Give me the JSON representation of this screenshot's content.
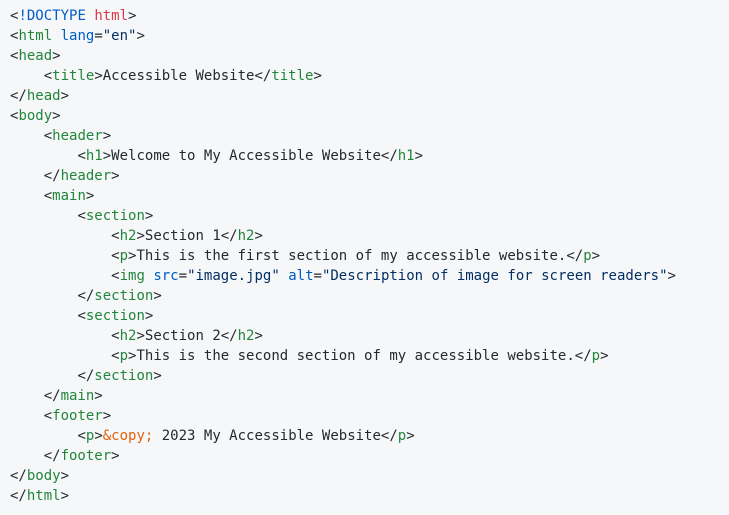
{
  "colors": {
    "background": "#f6f7f9",
    "text": "#24292e",
    "tag": "#22863a",
    "attr": "#005cc5",
    "string": "#032f62",
    "entity": "#e36209",
    "keyword": "#d73a49"
  },
  "lines": [
    [
      [
        "<",
        "p"
      ],
      [
        "!DOCTYPE",
        "doctype"
      ],
      [
        " ",
        "text"
      ],
      [
        "html",
        "red"
      ],
      [
        ">",
        "p"
      ]
    ],
    [
      [
        "<",
        "p"
      ],
      [
        "html",
        "tag"
      ],
      [
        " ",
        "text"
      ],
      [
        "lang",
        "attr"
      ],
      [
        "=",
        "p"
      ],
      [
        "\"en\"",
        "str"
      ],
      [
        ">",
        "p"
      ]
    ],
    [
      [
        "<",
        "p"
      ],
      [
        "head",
        "tag"
      ],
      [
        ">",
        "p"
      ]
    ],
    [
      [
        "    ",
        "text"
      ],
      [
        "<",
        "p"
      ],
      [
        "title",
        "tag"
      ],
      [
        ">",
        "p"
      ],
      [
        "Accessible Website",
        "text"
      ],
      [
        "</",
        "p"
      ],
      [
        "title",
        "tag"
      ],
      [
        ">",
        "p"
      ]
    ],
    [
      [
        "</",
        "p"
      ],
      [
        "head",
        "tag"
      ],
      [
        ">",
        "p"
      ]
    ],
    [
      [
        "<",
        "p"
      ],
      [
        "body",
        "tag"
      ],
      [
        ">",
        "p"
      ]
    ],
    [
      [
        "    ",
        "text"
      ],
      [
        "<",
        "p"
      ],
      [
        "header",
        "tag"
      ],
      [
        ">",
        "p"
      ]
    ],
    [
      [
        "        ",
        "text"
      ],
      [
        "<",
        "p"
      ],
      [
        "h1",
        "tag"
      ],
      [
        ">",
        "p"
      ],
      [
        "Welcome to My Accessible Website",
        "text"
      ],
      [
        "</",
        "p"
      ],
      [
        "h1",
        "tag"
      ],
      [
        ">",
        "p"
      ]
    ],
    [
      [
        "    ",
        "text"
      ],
      [
        "</",
        "p"
      ],
      [
        "header",
        "tag"
      ],
      [
        ">",
        "p"
      ]
    ],
    [
      [
        "    ",
        "text"
      ],
      [
        "<",
        "p"
      ],
      [
        "main",
        "tag"
      ],
      [
        ">",
        "p"
      ]
    ],
    [
      [
        "        ",
        "text"
      ],
      [
        "<",
        "p"
      ],
      [
        "section",
        "tag"
      ],
      [
        ">",
        "p"
      ]
    ],
    [
      [
        "            ",
        "text"
      ],
      [
        "<",
        "p"
      ],
      [
        "h2",
        "tag"
      ],
      [
        ">",
        "p"
      ],
      [
        "Section 1",
        "text"
      ],
      [
        "</",
        "p"
      ],
      [
        "h2",
        "tag"
      ],
      [
        ">",
        "p"
      ]
    ],
    [
      [
        "            ",
        "text"
      ],
      [
        "<",
        "p"
      ],
      [
        "p",
        "tag"
      ],
      [
        ">",
        "p"
      ],
      [
        "This is the first section of my accessible website.",
        "text"
      ],
      [
        "</",
        "p"
      ],
      [
        "p",
        "tag"
      ],
      [
        ">",
        "p"
      ]
    ],
    [
      [
        "            ",
        "text"
      ],
      [
        "<",
        "p"
      ],
      [
        "img",
        "tag"
      ],
      [
        " ",
        "text"
      ],
      [
        "src",
        "attr"
      ],
      [
        "=",
        "p"
      ],
      [
        "\"image.jpg\"",
        "str"
      ],
      [
        " ",
        "text"
      ],
      [
        "alt",
        "attr"
      ],
      [
        "=",
        "p"
      ],
      [
        "\"Description of image for screen readers\"",
        "str"
      ],
      [
        ">",
        "p"
      ]
    ],
    [
      [
        "        ",
        "text"
      ],
      [
        "</",
        "p"
      ],
      [
        "section",
        "tag"
      ],
      [
        ">",
        "p"
      ]
    ],
    [
      [
        "        ",
        "text"
      ],
      [
        "<",
        "p"
      ],
      [
        "section",
        "tag"
      ],
      [
        ">",
        "p"
      ]
    ],
    [
      [
        "            ",
        "text"
      ],
      [
        "<",
        "p"
      ],
      [
        "h2",
        "tag"
      ],
      [
        ">",
        "p"
      ],
      [
        "Section 2",
        "text"
      ],
      [
        "</",
        "p"
      ],
      [
        "h2",
        "tag"
      ],
      [
        ">",
        "p"
      ]
    ],
    [
      [
        "            ",
        "text"
      ],
      [
        "<",
        "p"
      ],
      [
        "p",
        "tag"
      ],
      [
        ">",
        "p"
      ],
      [
        "This is the second section of my accessible website.",
        "text"
      ],
      [
        "</",
        "p"
      ],
      [
        "p",
        "tag"
      ],
      [
        ">",
        "p"
      ]
    ],
    [
      [
        "        ",
        "text"
      ],
      [
        "</",
        "p"
      ],
      [
        "section",
        "tag"
      ],
      [
        ">",
        "p"
      ]
    ],
    [
      [
        "    ",
        "text"
      ],
      [
        "</",
        "p"
      ],
      [
        "main",
        "tag"
      ],
      [
        ">",
        "p"
      ]
    ],
    [
      [
        "    ",
        "text"
      ],
      [
        "<",
        "p"
      ],
      [
        "footer",
        "tag"
      ],
      [
        ">",
        "p"
      ]
    ],
    [
      [
        "        ",
        "text"
      ],
      [
        "<",
        "p"
      ],
      [
        "p",
        "tag"
      ],
      [
        ">",
        "p"
      ],
      [
        "&copy;",
        "entity"
      ],
      [
        " 2023 My Accessible Website",
        "text"
      ],
      [
        "</",
        "p"
      ],
      [
        "p",
        "tag"
      ],
      [
        ">",
        "p"
      ]
    ],
    [
      [
        "    ",
        "text"
      ],
      [
        "</",
        "p"
      ],
      [
        "footer",
        "tag"
      ],
      [
        ">",
        "p"
      ]
    ],
    [
      [
        "</",
        "p"
      ],
      [
        "body",
        "tag"
      ],
      [
        ">",
        "p"
      ]
    ],
    [
      [
        "</",
        "p"
      ],
      [
        "html",
        "tag"
      ],
      [
        ">",
        "p"
      ]
    ]
  ]
}
